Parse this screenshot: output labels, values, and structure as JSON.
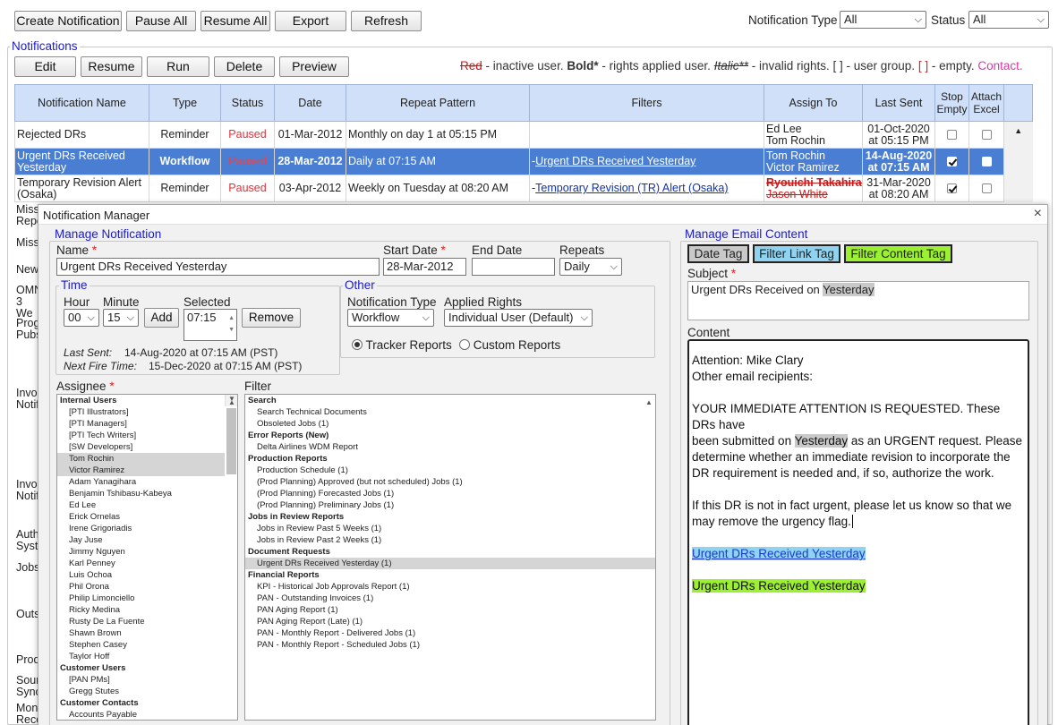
{
  "toolbar": {
    "create": "Create Notification",
    "pause_all": "Pause All",
    "resume_all": "Resume All",
    "export": "Export",
    "refresh": "Refresh",
    "notif_type_label": "Notification Type",
    "notif_type_value": "All",
    "status_label": "Status",
    "status_value": "All"
  },
  "notifications": {
    "legend": "Notifications",
    "buttons": {
      "edit": "Edit",
      "resume": "Resume",
      "run": "Run",
      "delete": "Delete",
      "preview": "Preview"
    },
    "key": {
      "red": "Red",
      "red_desc": "- inactive user.",
      "bold": "Bold*",
      "bold_desc": "- rights applied user.",
      "italic": "Italic**",
      "italic_desc": "- invalid rights. [ ] - user group.",
      "empty": "[ ]",
      "empty_desc": "- empty.",
      "contact": "Contact."
    },
    "columns": [
      "Notification Name",
      "Type",
      "Status",
      "Date",
      "Repeat Pattern",
      "Filters",
      "Assign To",
      "Last Sent",
      "Stop Empty",
      "Attach Excel"
    ],
    "rows": [
      {
        "name": "Rejected DRs",
        "type": "Reminder",
        "status": "Paused",
        "date": "01-Mar-2012",
        "repeat": "Monthly on day 1 at 05:15 PM",
        "filter": "",
        "assign1": "Ed Lee",
        "assign2": "Tom Rochin",
        "sent1": "01-Oct-2020",
        "sent2": "at 05:15 PM",
        "stop": false,
        "excel": false
      },
      {
        "name": "Urgent DRs Received Yesterday",
        "type": "Workflow",
        "status": "Paused",
        "date": "28-Mar-2012",
        "repeat": "Daily at 07:15 AM",
        "filter": "Urgent DRs Received Yesterday",
        "assign1": "Tom Rochin",
        "assign2": "Victor Ramirez",
        "sent1": "14-Aug-2020",
        "sent2": "at 07:15 AM",
        "stop": true,
        "excel": false
      },
      {
        "name": "Temporary Revision Alert (Osaka)",
        "type": "Reminder",
        "status": "Paused",
        "date": "03-Apr-2012",
        "repeat": "Weekly on Tuesday at 08:20 AM",
        "filter": "Temporary Revision (TR) Alert (Osaka)",
        "assign1": "Ryouichi Takahira*",
        "assign2": "Jason White",
        "sent1": "31-Mar-2020",
        "sent2": "at 08:20 AM",
        "stop": true,
        "excel": false
      }
    ],
    "left_fragments": [
      "Miss Repo",
      "Miss",
      "New",
      "OMN 3 We",
      "Prog Pubs",
      "Invoi Notif",
      "Invoi Notif",
      "Auth Syst",
      "Jobs",
      "Outs",
      "Prod",
      "Sour Sync",
      "Mont Reco"
    ]
  },
  "dialog": {
    "title": "Notification Manager",
    "close": "×",
    "manage_notification": "Manage Notification",
    "name_label": "Name",
    "name_value": "Urgent DRs Received Yesterday",
    "start_label": "Start Date",
    "start_value": "28-Mar-2012",
    "end_label": "End Date",
    "end_value": "",
    "repeats_label": "Repeats",
    "repeats_value": "Daily",
    "time_legend": "Time",
    "hour_label": "Hour",
    "hour_value": "00",
    "minute_label": "Minute",
    "minute_value": "15",
    "add": "Add",
    "selected_label": "Selected",
    "selected_value": "07:15",
    "remove": "Remove",
    "last_sent_label": "Last Sent:",
    "last_sent_value": "14-Aug-2020 at 07:15 AM (PST)",
    "next_fire_label": "Next Fire Time:",
    "next_fire_value": "15-Dec-2020 at 07:15 AM (PST)",
    "other_legend": "Other",
    "ntype_label": "Notification Type",
    "ntype_value": "Workflow",
    "rights_label": "Applied Rights",
    "rights_value": "Individual User (Default)",
    "tracker": "Tracker Reports",
    "custom": "Custom Reports",
    "assignee_label": "Assignee",
    "assignees": [
      {
        "t": "Internal Users",
        "g": true
      },
      {
        "t": "[PTI Illustrators]"
      },
      {
        "t": "[PTI Managers]"
      },
      {
        "t": "[PTI Tech Writers]"
      },
      {
        "t": "[SW Developers]"
      },
      {
        "t": "Tom Rochin",
        "h": true
      },
      {
        "t": "Victor Ramirez",
        "h": true
      },
      {
        "t": "Adam Yanagihara"
      },
      {
        "t": "Benjamin Tshibasu-Kabeya"
      },
      {
        "t": "Ed Lee"
      },
      {
        "t": "Erick Ornelas"
      },
      {
        "t": "Irene Grigoriadis"
      },
      {
        "t": "Jay Juse"
      },
      {
        "t": "Jimmy Nguyen"
      },
      {
        "t": "Karl Penney"
      },
      {
        "t": "Luis Ochoa"
      },
      {
        "t": "Phil Orona"
      },
      {
        "t": "Philip Limonciello"
      },
      {
        "t": "Ricky Medina"
      },
      {
        "t": "Rusty De La Fuente"
      },
      {
        "t": "Shawn Brown"
      },
      {
        "t": "Stephen Casey"
      },
      {
        "t": "Taylor Hoff"
      },
      {
        "t": "Customer Users",
        "g": true
      },
      {
        "t": "[PAN PMs]"
      },
      {
        "t": "Gregg Stutes"
      },
      {
        "t": "Customer Contacts",
        "g": true
      },
      {
        "t": "Accounts Payable"
      }
    ],
    "filter_label": "Filter",
    "filters": [
      {
        "t": "Search",
        "g": true
      },
      {
        "t": "Search Technical Documents"
      },
      {
        "t": "Obsoleted Jobs (1)"
      },
      {
        "t": "Error Reports (New)",
        "g": true
      },
      {
        "t": "Delta Airlines WDM Report"
      },
      {
        "t": "Production Reports",
        "g": true
      },
      {
        "t": "Production Schedule (1)"
      },
      {
        "t": "(Prod Planning) Approved (but not scheduled) Jobs (1)"
      },
      {
        "t": "(Prod Planning) Forecasted Jobs (1)"
      },
      {
        "t": "(Prod Planning) Preliminary Jobs (1)"
      },
      {
        "t": "Jobs in Review Reports",
        "g": true
      },
      {
        "t": "Jobs in Review Past 5 Weeks (1)"
      },
      {
        "t": "Jobs in Review Past 2 Weeks (1)"
      },
      {
        "t": "Document Requests",
        "g": true
      },
      {
        "t": "Urgent DRs Received Yesterday (1)",
        "h": true
      },
      {
        "t": "Financial Reports",
        "g": true
      },
      {
        "t": "KPI - Historical Job Approvals Report (1)"
      },
      {
        "t": "PAN - Outstanding Invoices (1)"
      },
      {
        "t": "PAN Aging Report (1)"
      },
      {
        "t": "PAN Aging Report (Late) (1)"
      },
      {
        "t": "PAN - Monthly Report - Delivered Jobs (1)"
      },
      {
        "t": "PAN - Monthly Report - Scheduled Jobs (1)"
      }
    ],
    "email": {
      "legend": "Manage Email Content",
      "date_tag": "Date Tag",
      "filter_link_tag": "Filter Link Tag",
      "filter_content_tag": "Filter Content Tag",
      "subject_label": "Subject",
      "subject_prefix": "Urgent DRs Received on ",
      "subject_tag": "Yesterday",
      "content_label": "Content",
      "attention": "Attention: Mike Clary",
      "other_recipients": "Other email recipients:",
      "p1a": "YOUR IMMEDIATE ATTENTION IS REQUESTED.  These DRs have",
      "p1b_pre": "been submitted on ",
      "p1b_tag": "Yesterday",
      "p1b_post": " as an URGENT request.  Please",
      "p1c": "determine whether an immediate revision to incorporate the",
      "p1d": "DR requirement is needed and, if so, authorize the work.",
      "p2a": "If this DR is not in fact urgent, please let us know so that we",
      "p2b": "may remove the urgency flag.",
      "link_tag": "Urgent DRs Received Yesterday",
      "content_tag": "Urgent DRs Received Yesterday"
    }
  },
  "colors": {
    "header_bg": "#cfe0f8",
    "selected_row": "#4a7ed2",
    "paused": "#e2303a",
    "legend": "#1a1ad0",
    "filter_link_tag": "#8fd3f0",
    "filter_content_tag": "#9cf032"
  }
}
